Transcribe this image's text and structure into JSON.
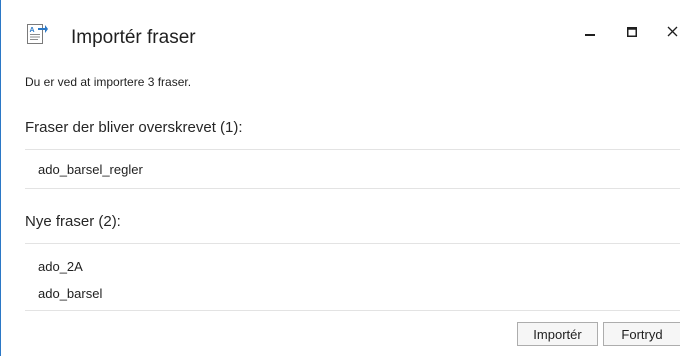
{
  "window": {
    "title": "Importér fraser",
    "controls": {
      "minimize": "minimize-icon",
      "maximize": "maximize-icon",
      "close": "close-icon"
    }
  },
  "dialog": {
    "intro": "Du er ved at importere 3 fraser.",
    "overwritten": {
      "title": "Fraser der bliver overskrevet (1):",
      "items": [
        "ado_barsel_regler"
      ]
    },
    "new": {
      "title": "Nye fraser (2):",
      "items": [
        "ado_2A",
        "ado_barsel"
      ]
    }
  },
  "buttons": {
    "import": "Importér",
    "cancel": "Fortryd"
  },
  "colors": {
    "window_border": "#2b78c6",
    "icon_blue": "#2b78c6",
    "divider": "#e3e3e3",
    "button_bg": "#f6f6f6",
    "button_border": "#adadad"
  }
}
